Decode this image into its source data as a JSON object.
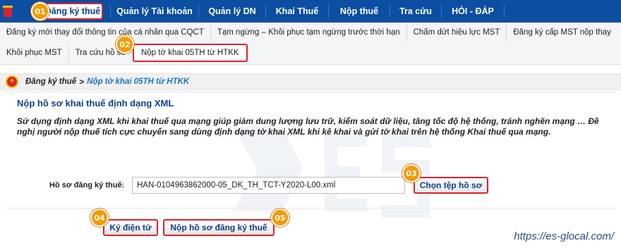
{
  "topnav": {
    "items": [
      {
        "label": "Đăng ký thuế",
        "active": true
      },
      {
        "label": "Quản lý Tài khoản"
      },
      {
        "label": "Quản lý DN"
      },
      {
        "label": "Khai Thuế"
      },
      {
        "label": "Nộp thuế"
      },
      {
        "label": "Tra cứu"
      },
      {
        "label": "HỎI - ĐÁP"
      }
    ]
  },
  "subnav": {
    "row1": [
      "Đăng ký mới thay đổi thông tin của cá nhân qua CQCT",
      "Tạm ngừng – Khôi phục tạm ngừng trước thời hạn",
      "Chấm dứt hiệu lực MST",
      "Đăng ký cấp MST nộp thay"
    ],
    "row2": [
      "Khôi phục MST",
      "Tra cứu hồ sơ",
      "Nộp tờ khai 05TH từ HTKK"
    ]
  },
  "breadcrumb": {
    "home": "Đăng ký thuế",
    "separator": ">",
    "current": "Nộp tờ khai 05TH từ HTKK"
  },
  "panel": {
    "title": "Nộp hồ sơ khai thuế định dạng XML",
    "description": "Sử dụng định dạng XML khi khai thuế qua mạng giúp giảm dung lượng lưu trữ, kiểm soát dữ liệu, tăng tốc độ hệ thống, tránh nghẽn mạng … Đề nghị người nộp thuế tích cực chuyển sang dùng định dạng tờ khai XML khi kê khai và gửi tờ khai trên hệ thống Khai thuế qua mạng.",
    "file_label": "Hồ sơ đăng ký thuế:",
    "file_value": "HAN-0104963862000-05_DK_TH_TCT-Y2020-L00.xml",
    "choose_button": "Chọn tệp hồ sơ",
    "sign_button": "Ký điện tử",
    "submit_button": "Nộp hồ sơ đăng ký thuế"
  },
  "markers": [
    "01",
    "02",
    "03",
    "04",
    "05"
  ],
  "watermark": {
    "url": "https://es-glocal.com/"
  },
  "colors": {
    "nav": "#0c4ea2",
    "highlight": "#d9232d",
    "marker": "#f59a00",
    "link": "#1a73c7"
  }
}
